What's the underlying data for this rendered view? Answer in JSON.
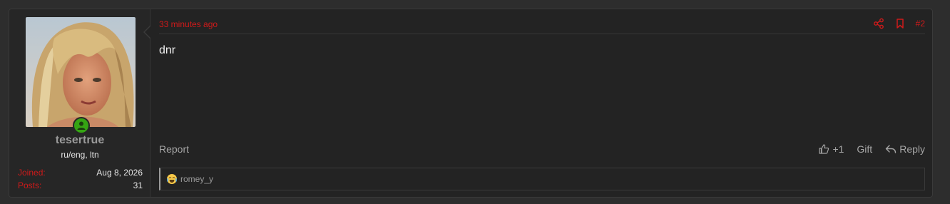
{
  "user": {
    "name": "tesertrue",
    "title": "ru/eng, ltn",
    "stats": [
      {
        "key": "Joined:",
        "value": "Aug 8, 2026"
      },
      {
        "key": "Posts:",
        "value": "31"
      }
    ]
  },
  "post": {
    "time": "33 minutes ago",
    "number": "#2",
    "content": "dnr",
    "report_label": "Report",
    "like_label": "+1",
    "gift_label": "Gift",
    "reply_label": "Reply"
  },
  "reactions": {
    "user": "romey_y"
  },
  "colors": {
    "accent": "#d01a1a",
    "online": "#35a413",
    "background": "#232323"
  },
  "icons": [
    "online-user-icon",
    "share-icon",
    "bookmark-icon",
    "thumbs-up-icon",
    "reply-icon",
    "crying-laughing-emoji"
  ]
}
